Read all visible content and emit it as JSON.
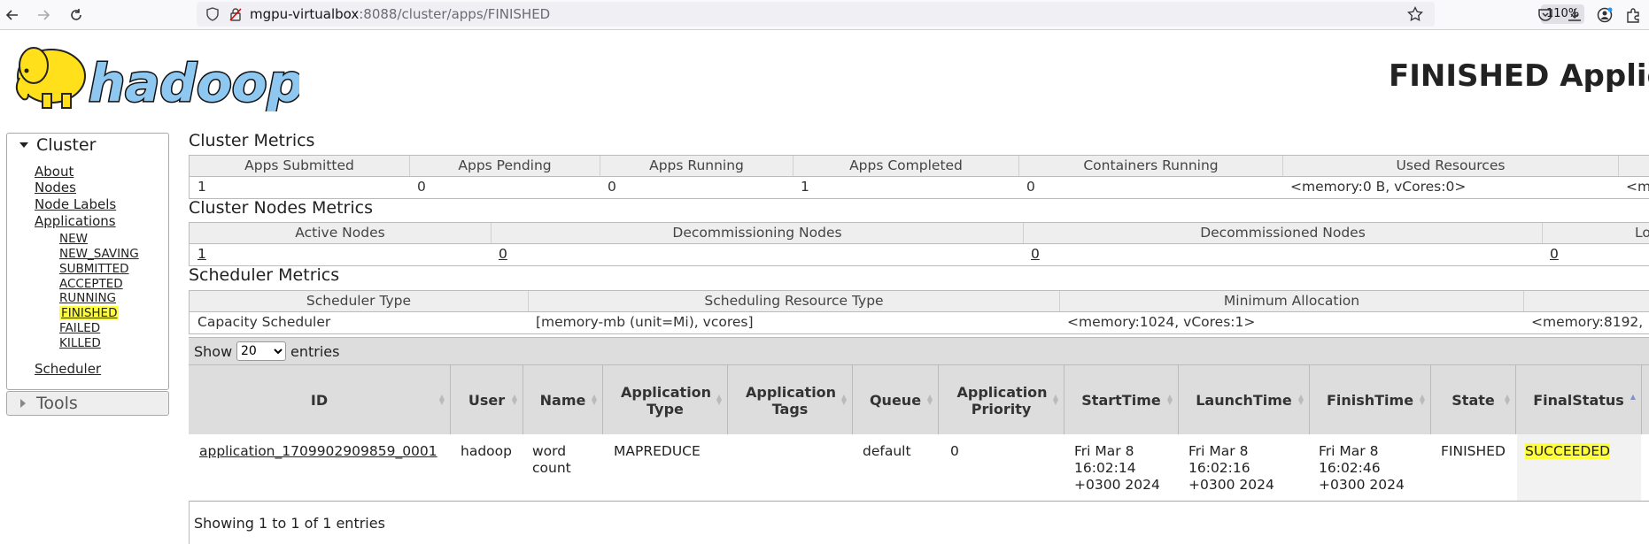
{
  "browser": {
    "url_host": "mgpu-virtualbox",
    "url_rest": ":8088/cluster/apps/FINISHED",
    "zoom": "110%"
  },
  "page": {
    "heading": "FINISHED Applica"
  },
  "nav": {
    "cluster_label": "Cluster",
    "about": "About",
    "nodes": "Nodes",
    "node_labels": "Node Labels",
    "applications": "Applications",
    "states": [
      "NEW",
      "NEW_SAVING",
      "SUBMITTED",
      "ACCEPTED",
      "RUNNING",
      "FINISHED",
      "FAILED",
      "KILLED"
    ],
    "scheduler": "Scheduler",
    "tools_label": "Tools"
  },
  "cluster_metrics": {
    "title": "Cluster Metrics",
    "headers": [
      "Apps Submitted",
      "Apps Pending",
      "Apps Running",
      "Apps Completed",
      "Containers Running",
      "Used Resources",
      ""
    ],
    "values": [
      "1",
      "0",
      "0",
      "1",
      "0",
      "<memory:0 B, vCores:0>",
      "<m"
    ]
  },
  "nodes_metrics": {
    "title": "Cluster Nodes Metrics",
    "headers": [
      "Active Nodes",
      "Decommissioning Nodes",
      "Decommissioned Nodes",
      "Lo"
    ],
    "values": [
      "1",
      "0",
      "0",
      "0"
    ]
  },
  "scheduler_metrics": {
    "title": "Scheduler Metrics",
    "headers": [
      "Scheduler Type",
      "Scheduling Resource Type",
      "Minimum Allocation",
      ""
    ],
    "values": [
      "Capacity Scheduler",
      "[memory-mb (unit=Mi), vcores]",
      "<memory:1024, vCores:1>",
      "<memory:8192,"
    ]
  },
  "apps": {
    "show_label": "Show",
    "page_size": "20",
    "entries_label": "entries",
    "columns": [
      "ID",
      "User",
      "Name",
      "Application Type",
      "Application Tags",
      "Queue",
      "Application Priority",
      "StartTime",
      "LaunchTime",
      "FinishTime",
      "State",
      "FinalStatus"
    ],
    "row": {
      "id": "application_1709902909859_0001",
      "user": "hadoop",
      "name": "word count",
      "type": "MAPREDUCE",
      "tags": "",
      "queue": "default",
      "priority": "0",
      "start": "Fri Mar 8 16:02:14 +0300 2024",
      "launch": "Fri Mar 8 16:02:16 +0300 2024",
      "finish": "Fri Mar 8 16:02:46 +0300 2024",
      "state": "FINISHED",
      "final_status": "SUCCEEDED"
    },
    "footer": "Showing 1 to 1 of 1 entries"
  },
  "colors": {
    "highlight": "#ffff3c",
    "logo_blue": "#8ec8f0",
    "logo_yellow": "#ffe01a"
  }
}
